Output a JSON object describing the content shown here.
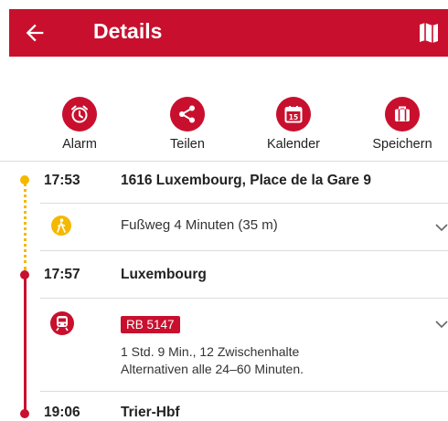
{
  "header": {
    "title": "Details",
    "back_icon": "arrow-left-icon",
    "map_icon": "map-icon",
    "color": "#c8102e"
  },
  "actions": [
    {
      "label": "Alarm",
      "icon": "alarm-clock-icon"
    },
    {
      "label": "Teilen",
      "icon": "share-icon"
    },
    {
      "label": "Kalender",
      "icon": "calendar-icon",
      "calendar_day": "15"
    },
    {
      "label": "Speichern",
      "icon": "briefcase-icon"
    }
  ],
  "journey": {
    "stop1": {
      "time": "17:53",
      "name": "1616 Luxembourg, Place de la Gare 9"
    },
    "walk": {
      "text": "Fußweg 4 Minuten (35 m)",
      "icon": "walking-person-icon",
      "color": "#f5b800"
    },
    "stop2": {
      "time": "17:57",
      "name": "Luxembourg"
    },
    "train": {
      "badge": "RB 5147",
      "line1": "1 Std. 9 Min., 12 Zwischenhalte",
      "line2": "Alternativen alle 24–60 Minuten.",
      "icon": "train-icon",
      "color": "#c8102e"
    },
    "stop3": {
      "time": "19:06",
      "name": "Trier-Hbf"
    }
  }
}
